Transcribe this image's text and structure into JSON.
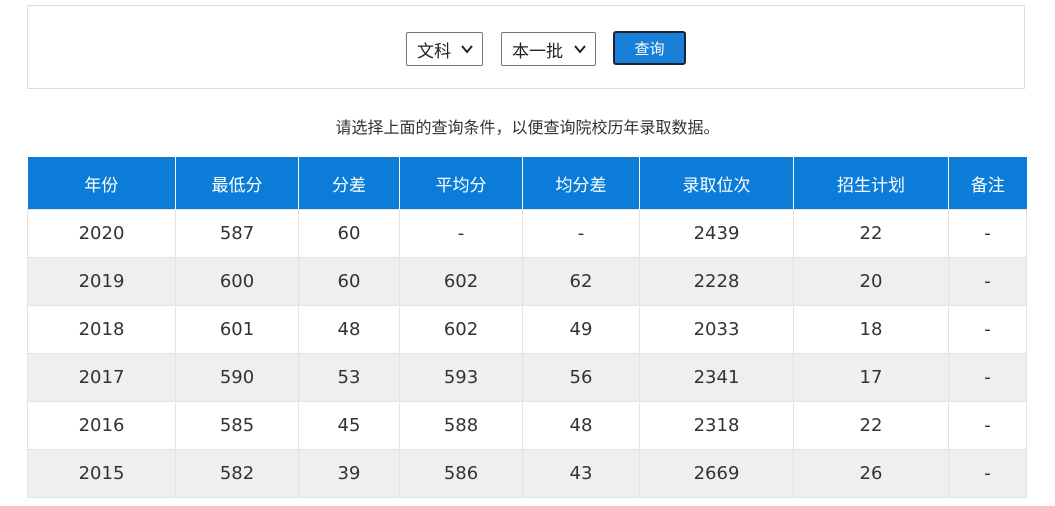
{
  "query": {
    "type_select": "文科",
    "batch_select": "本一批",
    "button": "查询"
  },
  "hint": "请选择上面的查询条件，以便查询院校历年录取数据。",
  "table": {
    "headers": [
      "年份",
      "最低分",
      "分差",
      "平均分",
      "均分差",
      "录取位次",
      "招生计划",
      "备注"
    ],
    "rows": [
      [
        "2020",
        "587",
        "60",
        "-",
        "-",
        "2439",
        "22",
        "-"
      ],
      [
        "2019",
        "600",
        "60",
        "602",
        "62",
        "2228",
        "20",
        "-"
      ],
      [
        "2018",
        "601",
        "48",
        "602",
        "49",
        "2033",
        "18",
        "-"
      ],
      [
        "2017",
        "590",
        "53",
        "593",
        "56",
        "2341",
        "17",
        "-"
      ],
      [
        "2016",
        "585",
        "45",
        "588",
        "48",
        "2318",
        "22",
        "-"
      ],
      [
        "2015",
        "582",
        "39",
        "586",
        "43",
        "2669",
        "26",
        "-"
      ]
    ]
  },
  "colors": {
    "header_bg": "#0b7dd9",
    "button_bg": "#1a7fd9",
    "stripe": "#efefef"
  },
  "icons": {
    "dropdown": "chevron-down-icon"
  }
}
